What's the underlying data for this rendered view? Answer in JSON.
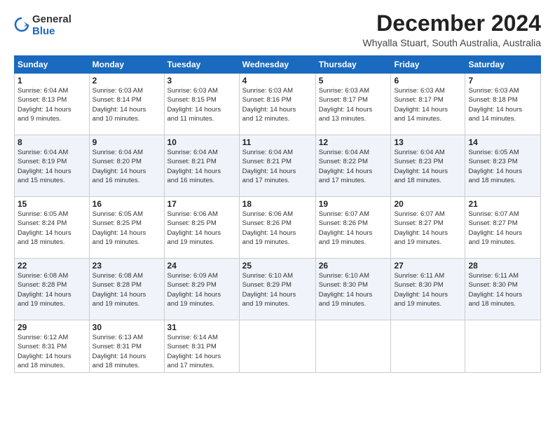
{
  "logo": {
    "general": "General",
    "blue": "Blue"
  },
  "title": "December 2024",
  "location": "Whyalla Stuart, South Australia, Australia",
  "weekdays": [
    "Sunday",
    "Monday",
    "Tuesday",
    "Wednesday",
    "Thursday",
    "Friday",
    "Saturday"
  ],
  "weeks": [
    [
      {
        "day": "1",
        "sunrise": "6:04 AM",
        "sunset": "8:13 PM",
        "daylight": "14 hours and 9 minutes."
      },
      {
        "day": "2",
        "sunrise": "6:03 AM",
        "sunset": "8:14 PM",
        "daylight": "14 hours and 10 minutes."
      },
      {
        "day": "3",
        "sunrise": "6:03 AM",
        "sunset": "8:15 PM",
        "daylight": "14 hours and 11 minutes."
      },
      {
        "day": "4",
        "sunrise": "6:03 AM",
        "sunset": "8:16 PM",
        "daylight": "14 hours and 12 minutes."
      },
      {
        "day": "5",
        "sunrise": "6:03 AM",
        "sunset": "8:17 PM",
        "daylight": "14 hours and 13 minutes."
      },
      {
        "day": "6",
        "sunrise": "6:03 AM",
        "sunset": "8:17 PM",
        "daylight": "14 hours and 14 minutes."
      },
      {
        "day": "7",
        "sunrise": "6:03 AM",
        "sunset": "8:18 PM",
        "daylight": "14 hours and 14 minutes."
      }
    ],
    [
      {
        "day": "8",
        "sunrise": "6:04 AM",
        "sunset": "8:19 PM",
        "daylight": "14 hours and 15 minutes."
      },
      {
        "day": "9",
        "sunrise": "6:04 AM",
        "sunset": "8:20 PM",
        "daylight": "14 hours and 16 minutes."
      },
      {
        "day": "10",
        "sunrise": "6:04 AM",
        "sunset": "8:21 PM",
        "daylight": "14 hours and 16 minutes."
      },
      {
        "day": "11",
        "sunrise": "6:04 AM",
        "sunset": "8:21 PM",
        "daylight": "14 hours and 17 minutes."
      },
      {
        "day": "12",
        "sunrise": "6:04 AM",
        "sunset": "8:22 PM",
        "daylight": "14 hours and 17 minutes."
      },
      {
        "day": "13",
        "sunrise": "6:04 AM",
        "sunset": "8:23 PM",
        "daylight": "14 hours and 18 minutes."
      },
      {
        "day": "14",
        "sunrise": "6:05 AM",
        "sunset": "8:23 PM",
        "daylight": "14 hours and 18 minutes."
      }
    ],
    [
      {
        "day": "15",
        "sunrise": "6:05 AM",
        "sunset": "8:24 PM",
        "daylight": "14 hours and 18 minutes."
      },
      {
        "day": "16",
        "sunrise": "6:05 AM",
        "sunset": "8:25 PM",
        "daylight": "14 hours and 19 minutes."
      },
      {
        "day": "17",
        "sunrise": "6:06 AM",
        "sunset": "8:25 PM",
        "daylight": "14 hours and 19 minutes."
      },
      {
        "day": "18",
        "sunrise": "6:06 AM",
        "sunset": "8:26 PM",
        "daylight": "14 hours and 19 minutes."
      },
      {
        "day": "19",
        "sunrise": "6:07 AM",
        "sunset": "8:26 PM",
        "daylight": "14 hours and 19 minutes."
      },
      {
        "day": "20",
        "sunrise": "6:07 AM",
        "sunset": "8:27 PM",
        "daylight": "14 hours and 19 minutes."
      },
      {
        "day": "21",
        "sunrise": "6:07 AM",
        "sunset": "8:27 PM",
        "daylight": "14 hours and 19 minutes."
      }
    ],
    [
      {
        "day": "22",
        "sunrise": "6:08 AM",
        "sunset": "8:28 PM",
        "daylight": "14 hours and 19 minutes."
      },
      {
        "day": "23",
        "sunrise": "6:08 AM",
        "sunset": "8:28 PM",
        "daylight": "14 hours and 19 minutes."
      },
      {
        "day": "24",
        "sunrise": "6:09 AM",
        "sunset": "8:29 PM",
        "daylight": "14 hours and 19 minutes."
      },
      {
        "day": "25",
        "sunrise": "6:10 AM",
        "sunset": "8:29 PM",
        "daylight": "14 hours and 19 minutes."
      },
      {
        "day": "26",
        "sunrise": "6:10 AM",
        "sunset": "8:30 PM",
        "daylight": "14 hours and 19 minutes."
      },
      {
        "day": "27",
        "sunrise": "6:11 AM",
        "sunset": "8:30 PM",
        "daylight": "14 hours and 19 minutes."
      },
      {
        "day": "28",
        "sunrise": "6:11 AM",
        "sunset": "8:30 PM",
        "daylight": "14 hours and 18 minutes."
      }
    ],
    [
      {
        "day": "29",
        "sunrise": "6:12 AM",
        "sunset": "8:31 PM",
        "daylight": "14 hours and 18 minutes."
      },
      {
        "day": "30",
        "sunrise": "6:13 AM",
        "sunset": "8:31 PM",
        "daylight": "14 hours and 18 minutes."
      },
      {
        "day": "31",
        "sunrise": "6:14 AM",
        "sunset": "8:31 PM",
        "daylight": "14 hours and 17 minutes."
      },
      null,
      null,
      null,
      null
    ]
  ]
}
